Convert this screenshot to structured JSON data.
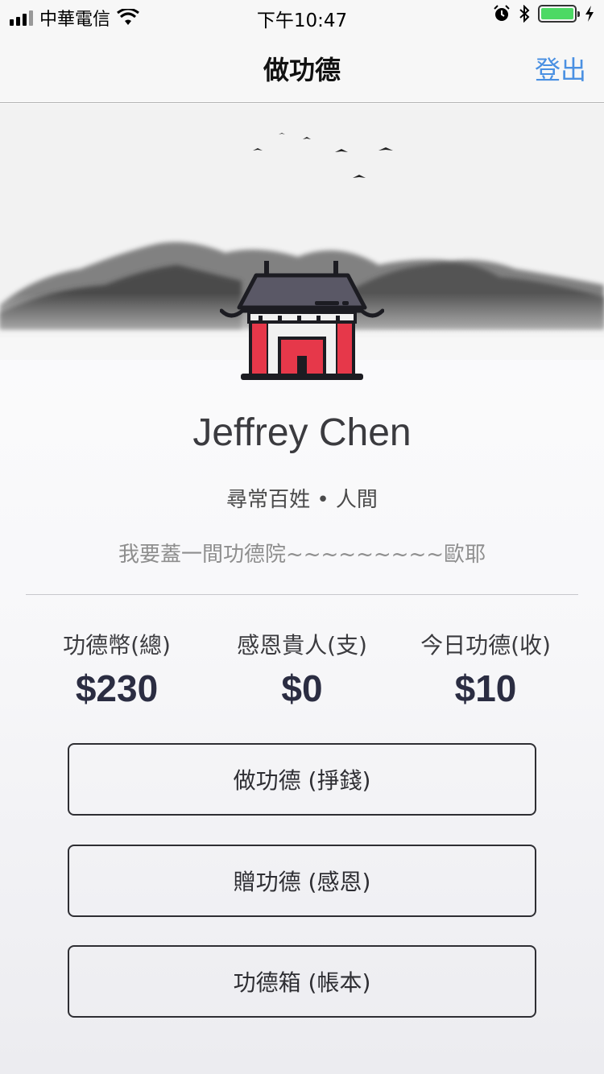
{
  "status_bar": {
    "carrier": "中華電信",
    "time": "下午10:47",
    "icons": [
      "signal-icon",
      "wifi-icon",
      "alarm-icon",
      "bluetooth-icon",
      "battery-icon",
      "charging-icon"
    ]
  },
  "nav": {
    "title": "做功德",
    "logout": "登出"
  },
  "profile": {
    "name": "Jeffrey Chen",
    "rank": "尋常百姓 • 人間",
    "motto": "我要蓋一間功德院~~~~~~~~~歐耶"
  },
  "stats": [
    {
      "label": "功德幣(總)",
      "value": "$230"
    },
    {
      "label": "感恩貴人(支)",
      "value": "$0"
    },
    {
      "label": "今日功德(收)",
      "value": "$10"
    }
  ],
  "actions": [
    {
      "label": "做功德 (掙錢)"
    },
    {
      "label": "贈功德 (感恩)"
    },
    {
      "label": "功德箱 (帳本)"
    }
  ],
  "colors": {
    "accent": "#4a90e2",
    "temple_red": "#e6384a",
    "temple_roof": "#5a5866",
    "battery": "#4cd964"
  }
}
